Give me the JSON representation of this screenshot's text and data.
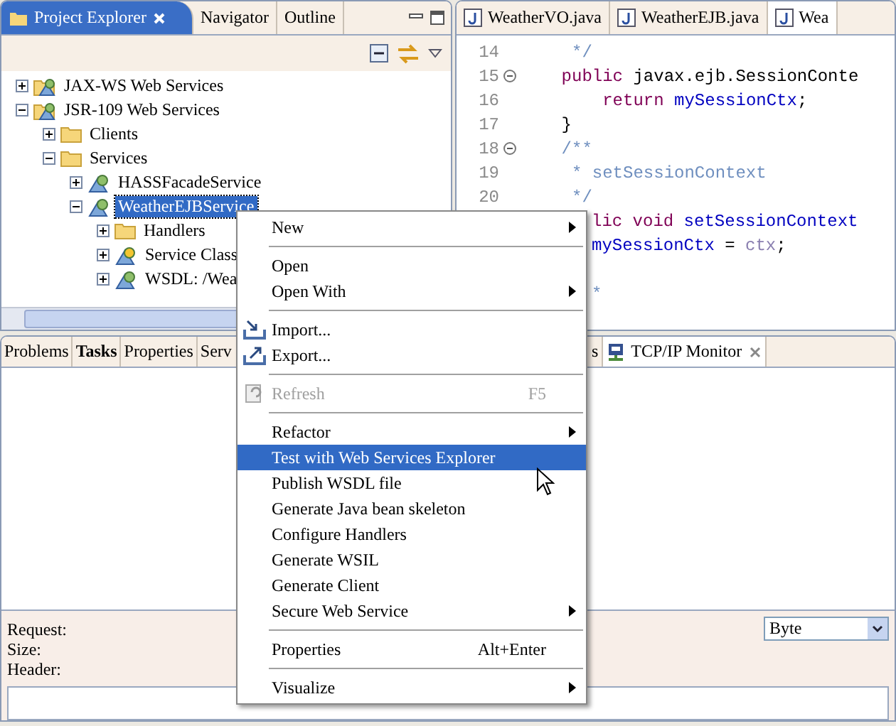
{
  "explorer": {
    "tabs": [
      {
        "label": "Project Explorer",
        "selected": true
      },
      {
        "label": "Navigator",
        "selected": false
      },
      {
        "label": "Outline",
        "selected": false
      }
    ],
    "tree": [
      {
        "label": "JAX-WS Web Services",
        "kind": "service-group",
        "expanded": false,
        "selected": false
      },
      {
        "label": "JSR-109 Web Services",
        "kind": "service-group",
        "expanded": true,
        "selected": false,
        "children": [
          {
            "label": "Clients",
            "kind": "folder",
            "expanded": false,
            "selected": false
          },
          {
            "label": "Services",
            "kind": "folder",
            "expanded": true,
            "selected": false,
            "children": [
              {
                "label": "HASSFacadeService",
                "kind": "service",
                "expanded": false,
                "selected": false
              },
              {
                "label": "WeatherEJBService",
                "kind": "service",
                "expanded": true,
                "selected": true,
                "children": [
                  {
                    "label": "Handlers",
                    "kind": "folder",
                    "expanded": false,
                    "selected": false
                  },
                  {
                    "label": "Service Class",
                    "kind": "service-class",
                    "expanded": false,
                    "selected": false
                  },
                  {
                    "label": "WSDL: /Wea",
                    "kind": "service",
                    "expanded": false,
                    "selected": false
                  }
                ]
              }
            ]
          }
        ]
      }
    ]
  },
  "editor": {
    "tabs": [
      {
        "label": "WeatherVO.java",
        "selected": false
      },
      {
        "label": "WeatherEJB.java",
        "selected": false
      },
      {
        "label": "Wea",
        "selected": true
      }
    ],
    "lines": [
      {
        "number": "14",
        "kind": "code",
        "folded": false,
        "tokens": [
          {
            "text": "     */",
            "kind": "comment"
          }
        ]
      },
      {
        "number": "15",
        "kind": "code",
        "folded": true,
        "tokens": [
          {
            "text": "    public",
            "kind": "keyword"
          },
          {
            "text": " javax.ejb.SessionConte",
            "kind": "plain"
          }
        ]
      },
      {
        "number": "16",
        "kind": "code",
        "folded": false,
        "tokens": [
          {
            "text": "        return",
            "kind": "keyword"
          },
          {
            "text": " mySessionCtx",
            "kind": "field"
          },
          {
            "text": ";",
            "kind": "plain"
          }
        ]
      },
      {
        "number": "17",
        "kind": "code",
        "folded": false,
        "tokens": [
          {
            "text": "    }",
            "kind": "plain"
          }
        ]
      },
      {
        "number": "18",
        "kind": "code",
        "folded": true,
        "tokens": [
          {
            "text": "    /**",
            "kind": "comment"
          }
        ]
      },
      {
        "number": "19",
        "kind": "code",
        "folded": false,
        "tokens": [
          {
            "text": "     * setSessionContext",
            "kind": "comment"
          }
        ]
      },
      {
        "number": "20",
        "kind": "code",
        "folded": false,
        "tokens": [
          {
            "text": "     */",
            "kind": "comment"
          }
        ]
      },
      {
        "kind": "tail",
        "tokens": [
          {
            "text": "lic void",
            "kind": "keyword"
          },
          {
            "text": " setSessionContext",
            "kind": "field"
          }
        ]
      },
      {
        "kind": "tail",
        "tokens": [
          {
            "text": "mySessionCtx",
            "kind": "field"
          },
          {
            "text": " = ",
            "kind": "plain"
          },
          {
            "text": "ctx",
            "kind": "param"
          },
          {
            "text": ";",
            "kind": "plain"
          }
        ]
      },
      {
        "kind": "blank"
      },
      {
        "kind": "tail",
        "tokens": [
          {
            "text": "*",
            "kind": "comment"
          }
        ]
      }
    ]
  },
  "bottom": {
    "tabs": [
      {
        "label": "Problems",
        "selected": false,
        "bold": false
      },
      {
        "label": "Tasks",
        "selected": false,
        "bold": true
      },
      {
        "label": "Properties",
        "selected": false,
        "bold": false
      },
      {
        "label": "Serv",
        "selected": false,
        "bold": false
      },
      {
        "label": "s",
        "selected": false,
        "bold": false
      },
      {
        "label": "TCP/IP Monitor",
        "selected": true,
        "bold": false
      }
    ],
    "labels": [
      "Request:",
      "Size:",
      "Header:"
    ],
    "encoding": {
      "value": "Byte"
    }
  },
  "context_menu": [
    {
      "kind": "item",
      "label": "New",
      "submenu": true,
      "selected": false
    },
    {
      "kind": "separator"
    },
    {
      "kind": "item",
      "label": "Open",
      "submenu": false,
      "selected": false
    },
    {
      "kind": "item",
      "label": "Open With",
      "submenu": true,
      "selected": false
    },
    {
      "kind": "separator"
    },
    {
      "kind": "import",
      "label": "Import...",
      "submenu": false,
      "selected": false
    },
    {
      "kind": "export",
      "label": "Export...",
      "submenu": false,
      "selected": false
    },
    {
      "kind": "separator"
    },
    {
      "kind": "refresh",
      "label": "Refresh",
      "shortcut": "F5",
      "disabled": true,
      "submenu": false,
      "selected": false
    },
    {
      "kind": "separator"
    },
    {
      "kind": "item",
      "label": "Refactor",
      "submenu": true,
      "selected": false
    },
    {
      "kind": "item",
      "label": "Test with Web Services Explorer",
      "submenu": false,
      "selected": true
    },
    {
      "kind": "item",
      "label": "Publish WSDL file",
      "submenu": false,
      "selected": false
    },
    {
      "kind": "item",
      "label": "Generate Java bean skeleton",
      "submenu": false,
      "selected": false
    },
    {
      "kind": "item",
      "label": "Configure Handlers",
      "submenu": false,
      "selected": false
    },
    {
      "kind": "item",
      "label": "Generate WSIL",
      "submenu": false,
      "selected": false
    },
    {
      "kind": "item",
      "label": "Generate Client",
      "submenu": false,
      "selected": false
    },
    {
      "kind": "item",
      "label": "Secure Web Service",
      "submenu": true,
      "selected": false
    },
    {
      "kind": "separator"
    },
    {
      "kind": "item",
      "label": "Properties",
      "shortcut": "Alt+Enter",
      "submenu": false,
      "selected": false
    },
    {
      "kind": "separator"
    },
    {
      "kind": "item",
      "label": "Visualize",
      "submenu": true,
      "selected": false
    }
  ]
}
